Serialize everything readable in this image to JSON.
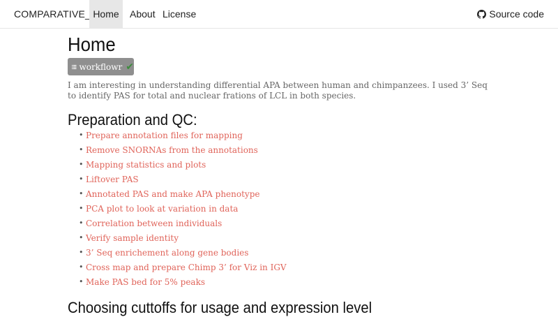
{
  "navbar": {
    "brand": "COMPARATIVE_APA",
    "items": [
      {
        "label": "Home",
        "active": true
      },
      {
        "label": "About",
        "active": false
      },
      {
        "label": "License",
        "active": false
      }
    ],
    "source": {
      "label": "Source code",
      "icon": "github-icon"
    }
  },
  "page": {
    "title": "Home",
    "workflowr_button": {
      "label": "workflowr",
      "icon_left": "list-icon",
      "icon_right": "check-icon"
    },
    "intro": "I am interesting in understanding differential APA between human and chimpanzees. I used 3’ Seq to identify PAS for total and nuclear frations of LCL in both species."
  },
  "sections": [
    {
      "heading": "Preparation and QC:",
      "links": [
        "Prepare annotation files for mapping",
        "Remove SNORNAs from the annotations",
        "Mapping statistics and plots",
        "Liftover PAS",
        "Annotated PAS and make APA phenotype",
        "PCA plot to look at variation in data",
        "Correlation between individuals",
        "Verify sample identity",
        "3’ Seq enrichement along gene bodies",
        "Cross map and prepare Chimp 3’ for Viz in IGV",
        "Make PAS bed for 5% peaks"
      ]
    },
    {
      "heading": "Choosing cuttoffs for usage and expression level",
      "links": []
    }
  ],
  "colors": {
    "link": "#e0645a",
    "nav_active_bg": "#e7e7e7",
    "workflowr_bg": "#8f8f8f",
    "check": "#3c8c3c"
  }
}
